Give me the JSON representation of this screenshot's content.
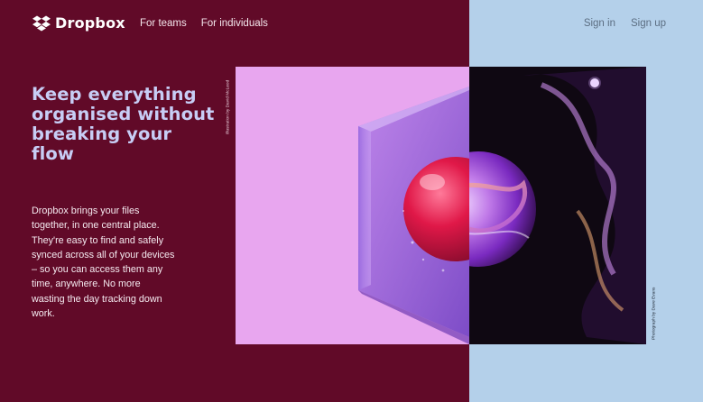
{
  "brand": {
    "name": "Dropbox",
    "logo_icon": "dropbox-box-icon"
  },
  "nav": {
    "left": [
      "For teams",
      "For individuals"
    ],
    "right": [
      "Sign in",
      "Sign up"
    ]
  },
  "hero": {
    "headline": "Keep everything organised without breaking your flow",
    "body": "Dropbox brings your files together, in one central place. They're easy to find and safely synced across all of your devices – so you can access them any time, anywhere. No more wasting the day tracking down work."
  },
  "credits": {
    "illustration": "Illustration by David McLeod",
    "photograph": "Photograph by Dave Evans"
  },
  "colors": {
    "left_bg": "#610a28",
    "right_bg": "#b4d0ea",
    "headline": "#c7cdf5",
    "illustration_bg": "#e8a6ef",
    "photo_bg": "#0f0812"
  }
}
